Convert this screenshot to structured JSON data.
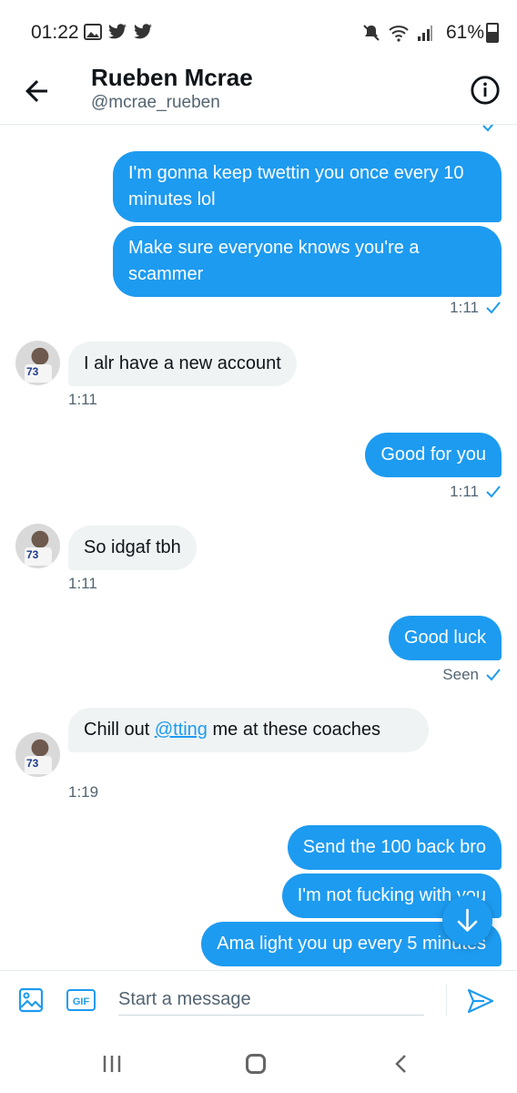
{
  "status_bar": {
    "time": "01:22",
    "battery": "61%"
  },
  "header": {
    "name": "Rueben Mcrae",
    "handle": "@mcrae_rueben"
  },
  "messages": [
    {
      "dir": "out",
      "text": "I'm gonna keep twettin you once every 10 minutes lol"
    },
    {
      "dir": "out",
      "text": "Make sure everyone knows you're a scammer",
      "time": "1:11"
    },
    {
      "dir": "in",
      "text": "I alr have a new account",
      "time": "1:11"
    },
    {
      "dir": "out",
      "text": "Good for you",
      "time": "1:11"
    },
    {
      "dir": "in",
      "text": "So idgaf tbh",
      "time": "1:11"
    },
    {
      "dir": "out",
      "text": "Good luck",
      "time": "Seen"
    },
    {
      "dir": "in",
      "text_before": "Chill out ",
      "mention": "@tting",
      "text_after": " me at these coaches",
      "time": "1:19"
    },
    {
      "dir": "out",
      "text": "Send the 100 back bro"
    },
    {
      "dir": "out",
      "text": "I'm not fucking with you"
    },
    {
      "dir": "out",
      "text": "Ama light you up every 5 minutes"
    }
  ],
  "composer": {
    "placeholder": "Start a message",
    "gif_label": "GIF"
  },
  "avatar_jersey_number": "73",
  "colors": {
    "accent": "#1d9bf0",
    "incoming_bubble": "#eff3f4",
    "muted_text": "#536471"
  }
}
